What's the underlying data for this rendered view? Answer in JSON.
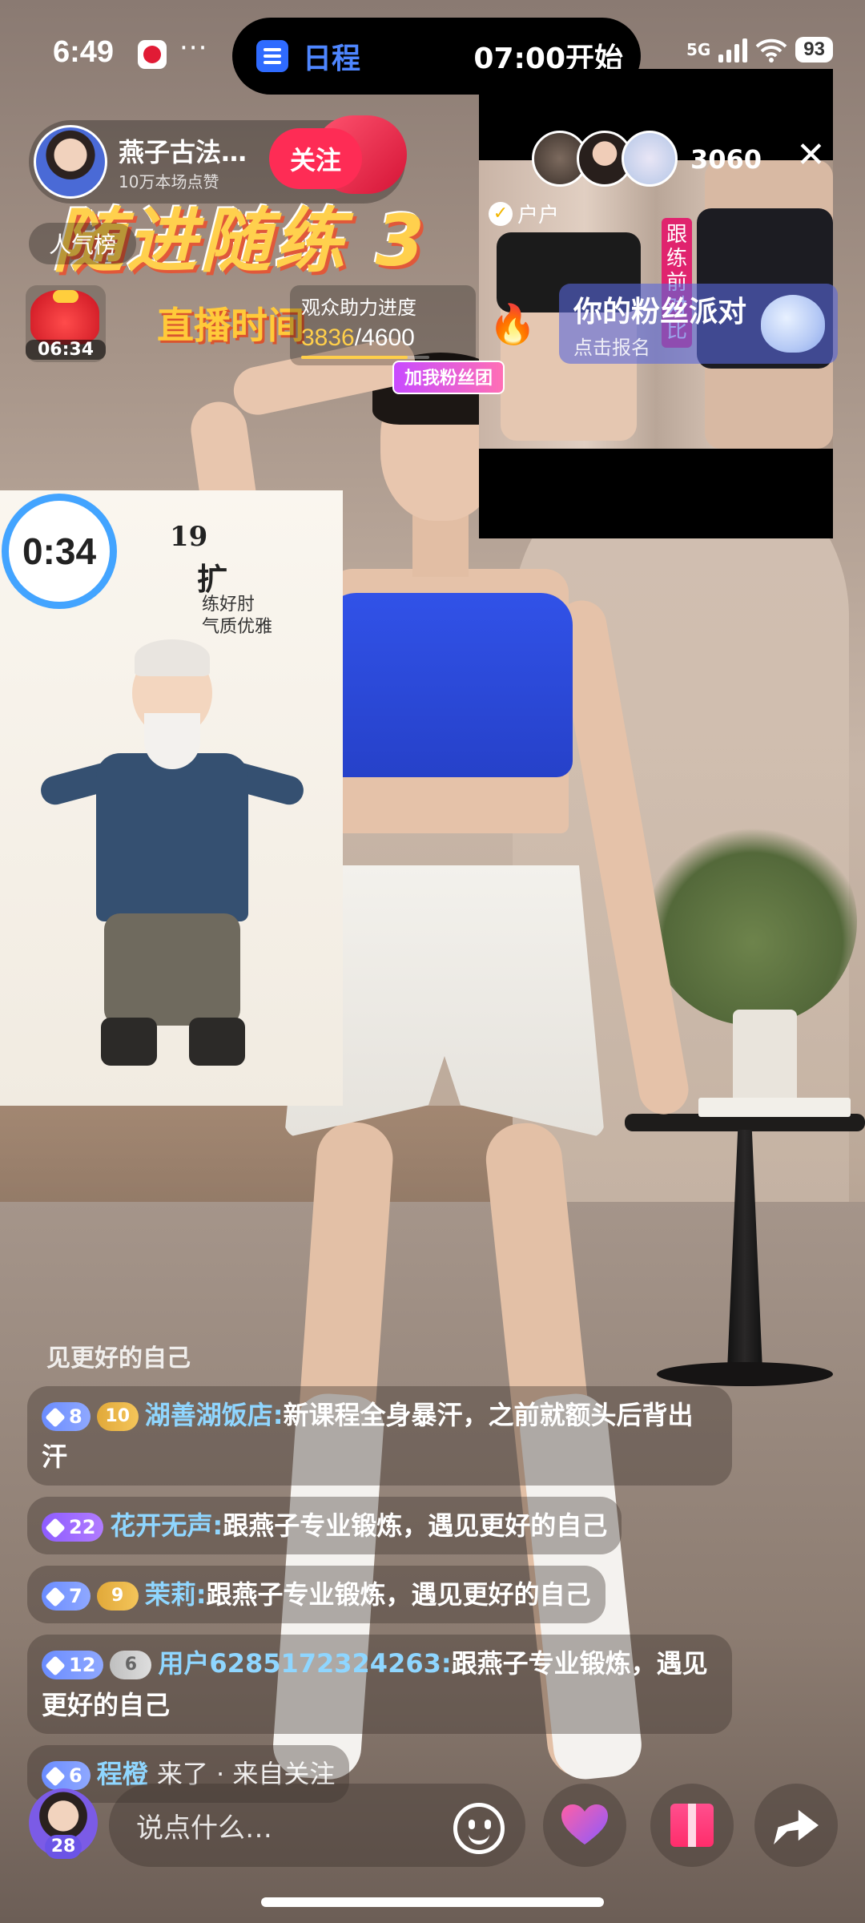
{
  "status_bar": {
    "time": "6:49",
    "more": "···",
    "network": "5G",
    "battery": "93"
  },
  "schedule": {
    "label": "日程",
    "start": "07:00开始"
  },
  "host": {
    "name": "燕子古法…",
    "subtitle": "10万本场点赞",
    "follow_label": "关注"
  },
  "viewers": {
    "count": "3060",
    "close_label": "✕"
  },
  "banner": {
    "title": "随进随练 3",
    "subtitle": "直播时间"
  },
  "ranking_label": "人气榜",
  "red_packet_time": "06:34",
  "progress": {
    "label": "观众助力进度",
    "current": "3836",
    "total": "/4600",
    "fraction": 0.834
  },
  "fan_party": {
    "title": "你的粉丝派对",
    "subtitle": "点击报名"
  },
  "join_fan_label": "加我粉丝团",
  "pip": {
    "tag": "户户",
    "vertical_label": "跟练前对比"
  },
  "course": {
    "timer": "0:34",
    "number": "19",
    "title": "扩",
    "line1": "练好肘",
    "line2": "气质优雅"
  },
  "chat": {
    "faded": "见更好的自己",
    "messages": [
      {
        "level": "8",
        "fan": "10",
        "fan_style": "gold",
        "level_style": "blue",
        "user": "湖善湖饭店:",
        "text": "新课程全身暴汗，之前就额头后背出汗"
      },
      {
        "level": "22",
        "fan": "",
        "fan_style": "",
        "level_style": "purple",
        "user": "花开无声:",
        "text": "跟燕子专业锻炼，遇见更好的自己"
      },
      {
        "level": "7",
        "fan": "9",
        "fan_style": "gold",
        "level_style": "blue",
        "user": "茉莉:",
        "text": "跟燕子专业锻炼，遇见更好的自己"
      },
      {
        "level": "12",
        "fan": "6",
        "fan_style": "gray",
        "level_style": "blue",
        "user": "用户6285172324263:",
        "text": "跟燕子专业锻炼，遇见更好的自己"
      },
      {
        "level": "6",
        "fan": "",
        "fan_style": "",
        "level_style": "blue",
        "user": "程橙",
        "text": "来了 · 来自关注"
      }
    ]
  },
  "bottom": {
    "my_level": "28",
    "input_placeholder": "说点什么…"
  }
}
